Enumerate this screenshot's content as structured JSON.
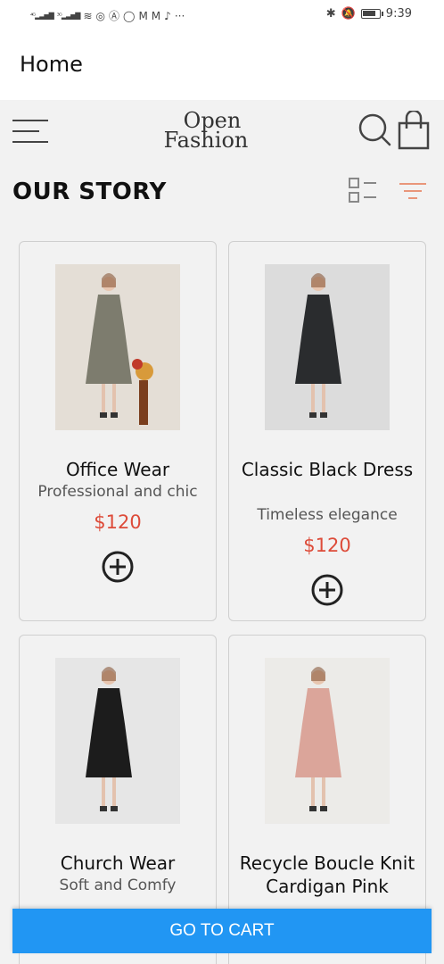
{
  "status_bar": {
    "left_glyphs": [
      "⁴ᴳ",
      "³ᴳ"
    ],
    "time": "9:39",
    "battery_level": 0.85
  },
  "app_bar": {
    "title": "Home"
  },
  "header": {
    "logo_line1": "Open",
    "logo_line2": "Fashion"
  },
  "section": {
    "title": "OUR STORY"
  },
  "products": [
    {
      "name": "Office Wear",
      "description": "Professional and chic",
      "price": "$120",
      "dress_color": "#7d7c6e",
      "bg_color": "#e4ded6"
    },
    {
      "name": "Classic Black Dress",
      "description": "Timeless elegance",
      "price": "$120",
      "dress_color": "#2a2c2e",
      "bg_color": "#dcdcdc"
    },
    {
      "name": "Church Wear",
      "description": "Soft and Comfy",
      "price": "",
      "dress_color": "#1c1c1c",
      "bg_color": "#e6e6e6"
    },
    {
      "name": "Recycle Boucle Knit Cardigan Pink",
      "description": "",
      "price": "",
      "dress_color": "#dba59a",
      "bg_color": "#ecebe8"
    }
  ],
  "cart_button": {
    "label": "GO TO CART"
  },
  "colors": {
    "accent": "#2196f3",
    "price": "#dd4b39",
    "filter": "#e9967a"
  }
}
